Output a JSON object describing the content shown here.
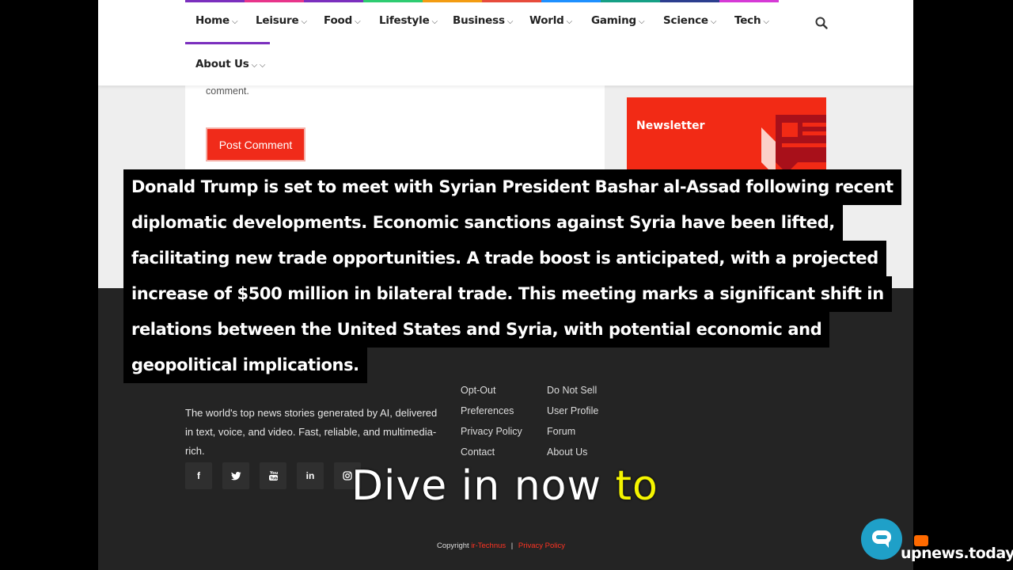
{
  "nav": {
    "items": [
      {
        "label": "Home"
      },
      {
        "label": "Leisure"
      },
      {
        "label": "Food"
      },
      {
        "label": "Lifestyle"
      },
      {
        "label": "Business"
      },
      {
        "label": "World"
      },
      {
        "label": "Gaming"
      },
      {
        "label": "Science"
      },
      {
        "label": "Tech"
      },
      {
        "label": "About Us"
      }
    ],
    "search_icon": "search-icon",
    "strip_colors": [
      "#7b2fbe",
      "#e8358a",
      "#7b2fbe",
      "#2ecc71",
      "#f39c12",
      "#e74c3c",
      "#1e90ff",
      "#16a085",
      "#2c3e8f",
      "#d63ad6"
    ]
  },
  "comment": {
    "hint": "comment.",
    "post_button": "Post Comment"
  },
  "newsletter": {
    "title": "Newsletter"
  },
  "caption": {
    "lines": [
      "Donald Trump is set to meet with Syrian President Bashar al-Assad following recent",
      "diplomatic developments. Economic sanctions against Syria have been lifted,",
      "facilitating new trade opportunities. A trade boost is anticipated, with a projected",
      "increase of $500 million in bilateral trade. This meeting marks a significant shift in",
      "relations between the United States and Syria, with potential economic and",
      "geopolitical implications."
    ]
  },
  "footer": {
    "description": "The world's top news stories generated by AI, delivered in text, voice, and video. Fast, reliable, and multimedia-rich.",
    "links_col1": [
      "Opt-Out",
      "Preferences",
      "Privacy Policy",
      "Contact"
    ],
    "links_col2": [
      "Do Not Sell",
      "User Profile",
      "Forum",
      "About Us"
    ],
    "social": [
      "f",
      "t",
      "yt",
      "in",
      "ig"
    ],
    "copyright": {
      "prefix": "Copyright",
      "brand": "ir-Technus",
      "sep": "|",
      "policy": "Privacy Policy"
    }
  },
  "subtitle": {
    "main": "Dive in now",
    "highlight": "to"
  },
  "brand": {
    "text": "upnews.today",
    "accent": "#ff6a00"
  }
}
